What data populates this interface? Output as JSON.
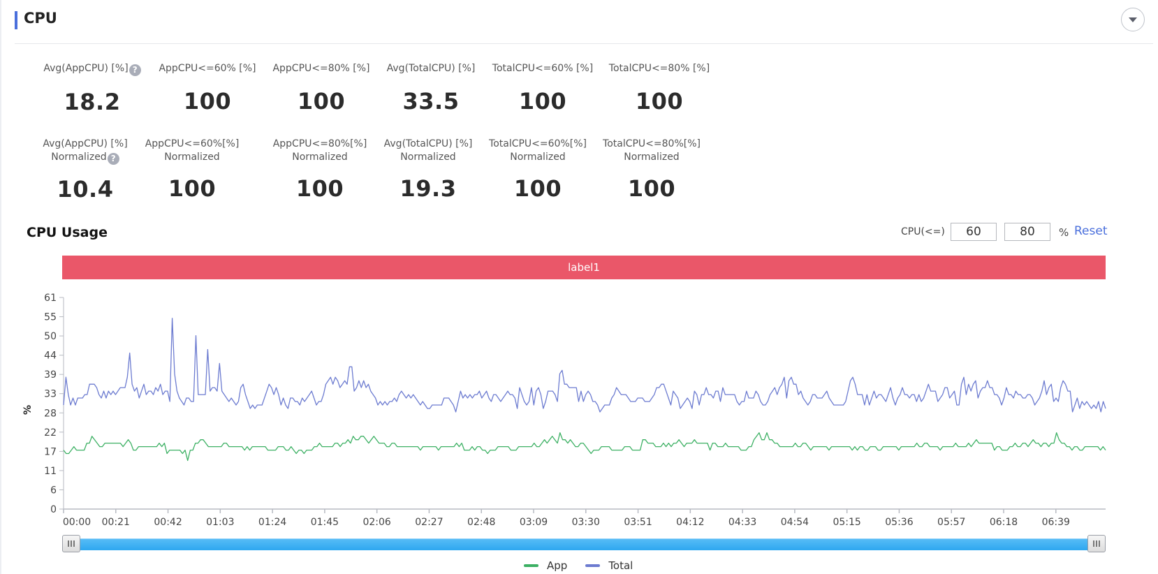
{
  "header": {
    "title": "CPU",
    "collapse_icon": "caret-down-icon"
  },
  "metrics_row1": [
    {
      "label": "Avg(AppCPU) [%]",
      "value": "18.2",
      "help": true
    },
    {
      "label": "AppCPU<=60% [%]",
      "value": "100"
    },
    {
      "label": "AppCPU<=80% [%]",
      "value": "100"
    },
    {
      "label": "Avg(TotalCPU) [%]",
      "value": "33.5"
    },
    {
      "label": "TotalCPU<=60% [%]",
      "value": "100"
    },
    {
      "label": "TotalCPU<=80% [%]",
      "value": "100"
    }
  ],
  "metrics_row2": [
    {
      "label": "Avg(AppCPU) [%]",
      "sublabel": "Normalized",
      "value": "10.4",
      "help": true
    },
    {
      "label": "AppCPU<=60%[%]",
      "sublabel": "Normalized",
      "value": "100"
    },
    {
      "label": "AppCPU<=80%[%]",
      "sublabel": "Normalized",
      "value": "100"
    },
    {
      "label": "Avg(TotalCPU) [%]",
      "sublabel": "Normalized",
      "value": "19.3"
    },
    {
      "label": "TotalCPU<=60%[%]",
      "sublabel": "Normalized",
      "value": "100"
    },
    {
      "label": "TotalCPU<=80%[%]",
      "sublabel": "Normalized",
      "value": "100"
    }
  ],
  "help_glyph": "?",
  "usage": {
    "title": "CPU Usage",
    "threshold_label": "CPU(<=)",
    "threshold_low": "60",
    "threshold_high": "80",
    "unit": "%",
    "reset_label": "Reset",
    "band_label": "label1",
    "band_color": "#ea5769"
  },
  "slider": {
    "range_start": 0,
    "range_end": 1
  },
  "chart_data": {
    "type": "line",
    "title": "CPU Usage",
    "xlabel": "",
    "ylabel": "%",
    "ylim": [
      0,
      61
    ],
    "yticks": [
      "0",
      "6",
      "11",
      "17",
      "22",
      "28",
      "33",
      "39",
      "44",
      "50",
      "55",
      "61"
    ],
    "xticks": [
      "00:00",
      "00:21",
      "00:42",
      "01:03",
      "01:24",
      "01:45",
      "02:06",
      "02:27",
      "02:48",
      "03:09",
      "03:30",
      "03:51",
      "04:12",
      "04:33",
      "04:54",
      "05:15",
      "05:36",
      "05:57",
      "06:18",
      "06:39"
    ],
    "x_range_seconds": [
      0,
      419
    ],
    "grid": false,
    "legend_position": "bottom-center",
    "series": [
      {
        "name": "App",
        "color": "#3cb063",
        "values": [
          17,
          16,
          16,
          17,
          18,
          17,
          17,
          17,
          17,
          19,
          19,
          21,
          20,
          19,
          18,
          18,
          19,
          19,
          19,
          19,
          19,
          19,
          19,
          18,
          19,
          20,
          19,
          17,
          17,
          18,
          18,
          18,
          18,
          18,
          18,
          18,
          18,
          19,
          18,
          19,
          16,
          17,
          17,
          17,
          17,
          17,
          16,
          17,
          14,
          17,
          17,
          19,
          19,
          20,
          20,
          19,
          18,
          18,
          18,
          18,
          18,
          18,
          19,
          19,
          18,
          18,
          18,
          18,
          18,
          18,
          17,
          18,
          17,
          18,
          18,
          18,
          18,
          18,
          18,
          17,
          17,
          17,
          17,
          18,
          18,
          18,
          17,
          17,
          18,
          17,
          16,
          17,
          17,
          16,
          17,
          17,
          17,
          18,
          18,
          19,
          18,
          18,
          18,
          18,
          18,
          19,
          19,
          18,
          19,
          19,
          20,
          19,
          21,
          20,
          20,
          21,
          21,
          20,
          19,
          20,
          21,
          20,
          19,
          19,
          19,
          18,
          18,
          19,
          19,
          18,
          18,
          18,
          18,
          18,
          18,
          18,
          18,
          18,
          17,
          18,
          18,
          18,
          18,
          18,
          18,
          17,
          18,
          18,
          18,
          18,
          18,
          18,
          19,
          18,
          19,
          17,
          17,
          17,
          18,
          17,
          18,
          18,
          17,
          17,
          16,
          17,
          17,
          17,
          18,
          18,
          18,
          18,
          18,
          17,
          17,
          17,
          18,
          18,
          18,
          18,
          18,
          18,
          19,
          18,
          18,
          19,
          20,
          19,
          20,
          21,
          20,
          19,
          22,
          20,
          20,
          19,
          20,
          19,
          18,
          18,
          19,
          19,
          18,
          17,
          16,
          17,
          17,
          17,
          18,
          18,
          18,
          18,
          17,
          17,
          17,
          17,
          17,
          18,
          18,
          18,
          17,
          17,
          17,
          17,
          20,
          20,
          19,
          19,
          19,
          18,
          18,
          18,
          19,
          18,
          19,
          18,
          19,
          19,
          20,
          19,
          18,
          19,
          19,
          19,
          20,
          19,
          19,
          19,
          19,
          19,
          17,
          19,
          19,
          18,
          18,
          18,
          19,
          18,
          18,
          18,
          18,
          18,
          17,
          17,
          17,
          18,
          18,
          20,
          21,
          22,
          20,
          20,
          22,
          20,
          20,
          19,
          19,
          18,
          18,
          18,
          18,
          18,
          18,
          19,
          18,
          18,
          19,
          19,
          18,
          17,
          18,
          18,
          18,
          18,
          18,
          18,
          17,
          18,
          18,
          18,
          18,
          18,
          18,
          18,
          18,
          17,
          18,
          17,
          18,
          18,
          17,
          17,
          18,
          18,
          18,
          17,
          17,
          18,
          18,
          18,
          18,
          18,
          18,
          17,
          18,
          18,
          18,
          18,
          18,
          18,
          19,
          18,
          18,
          19,
          19,
          18,
          18,
          18,
          18,
          17,
          18,
          18,
          18,
          18,
          18,
          19,
          18,
          18,
          18,
          18,
          19,
          18,
          19,
          20,
          19,
          19,
          19,
          19,
          19,
          19,
          17,
          18,
          18,
          17,
          17,
          17,
          18,
          18,
          19,
          18,
          18,
          19,
          19,
          18,
          19,
          20,
          19,
          19,
          18,
          19,
          19,
          18,
          19,
          19,
          22,
          20,
          19,
          19,
          18,
          18,
          17,
          18,
          18,
          17,
          17,
          18,
          18,
          18,
          18,
          18,
          18,
          17,
          18,
          17
        ]
      },
      {
        "name": "Total",
        "color": "#6c7bd0",
        "values": [
          30,
          38,
          33,
          30,
          32,
          30,
          32,
          32,
          32,
          33,
          33,
          36,
          36,
          36,
          35,
          33,
          32,
          34,
          32,
          34,
          33,
          34,
          33,
          34,
          35,
          35,
          35,
          38,
          45,
          36,
          34,
          35,
          32,
          34,
          36,
          33,
          34,
          34,
          33,
          35,
          34,
          36,
          33,
          34,
          34,
          31,
          55,
          39,
          34,
          32,
          31,
          30,
          32,
          32,
          31,
          31,
          50,
          33,
          33,
          33,
          33,
          46,
          34,
          35,
          35,
          34,
          42,
          34,
          33,
          32,
          31,
          32,
          31,
          30,
          31,
          35,
          36,
          33,
          31,
          29,
          30,
          29,
          30,
          30,
          30,
          32,
          34,
          36,
          35,
          33,
          35,
          33,
          30,
          32,
          30,
          29,
          32,
          32,
          31,
          31,
          30,
          32,
          31,
          32,
          33,
          34,
          32,
          30,
          31,
          31,
          33,
          36,
          37,
          38,
          36,
          38,
          37,
          35,
          36,
          37,
          36,
          41,
          41,
          34,
          35,
          37,
          35,
          37,
          35,
          36,
          34,
          33,
          32,
          30,
          31,
          30,
          31,
          30,
          31,
          31,
          32,
          31,
          33,
          34,
          33,
          32,
          33,
          32,
          33,
          32,
          31,
          30,
          31,
          30,
          29,
          29,
          30,
          30,
          30,
          30,
          30,
          32,
          32,
          32,
          31,
          30,
          28,
          31,
          34,
          32,
          33,
          32,
          33,
          32,
          33,
          33,
          34,
          32,
          33,
          34,
          32,
          31,
          33,
          33,
          32,
          31,
          32,
          33,
          34,
          33,
          33,
          32,
          29,
          35,
          33,
          31,
          30,
          31,
          35,
          30,
          34,
          35,
          33,
          29,
          31,
          34,
          34,
          34,
          33,
          31,
          39,
          40,
          36,
          36,
          35,
          35,
          35,
          35,
          31,
          34,
          31,
          33,
          34,
          33,
          31,
          31,
          30,
          28,
          29,
          30,
          30,
          30,
          32,
          33,
          35,
          34,
          33,
          33,
          33,
          32,
          31,
          31,
          31,
          32,
          32,
          32,
          31,
          31,
          31,
          32,
          33,
          35,
          35,
          36,
          36,
          34,
          32,
          30,
          34,
          33,
          32,
          29,
          30,
          31,
          32,
          31,
          29,
          34,
          33,
          30,
          33,
          33,
          35,
          33,
          33,
          32,
          34,
          34,
          31,
          35,
          33,
          33,
          33,
          33,
          33,
          31,
          30,
          31,
          31,
          34,
          32,
          32,
          32,
          34,
          33,
          31,
          30,
          30,
          31,
          33,
          34,
          35,
          33,
          35,
          36,
          38,
          32,
          37,
          38,
          36,
          36,
          33,
          34,
          32,
          31,
          30,
          31,
          33,
          33,
          32,
          32,
          32,
          33,
          34,
          32,
          31,
          30,
          30,
          30,
          30,
          30,
          31,
          34,
          37,
          38,
          36,
          33,
          33,
          33,
          30,
          33,
          30,
          32,
          34,
          32,
          33,
          33,
          32,
          31,
          33,
          35,
          32,
          30,
          32,
          33,
          35,
          33,
          33,
          32,
          33,
          33,
          31,
          33,
          31,
          32,
          34,
          36,
          34,
          34,
          34,
          31,
          32,
          33,
          35,
          35,
          32,
          33,
          34,
          30,
          30,
          36,
          38,
          33,
          36,
          34,
          36,
          37,
          32,
          34,
          35,
          35,
          37,
          35,
          35,
          33,
          33,
          32,
          30,
          32,
          35,
          33,
          33,
          32,
          34,
          33,
          33,
          32,
          32,
          33,
          33,
          32,
          30,
          31,
          32,
          34,
          37,
          33,
          35,
          36,
          31,
          32,
          31,
          35,
          37,
          36,
          34,
          34,
          28,
          30,
          32,
          29,
          31,
          30,
          31,
          30,
          29,
          30,
          29,
          31,
          28,
          31,
          29
        ]
      }
    ]
  }
}
